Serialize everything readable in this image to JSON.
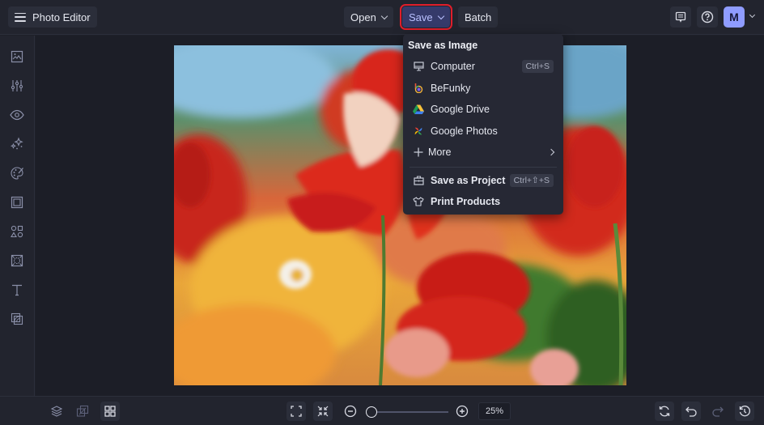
{
  "app": {
    "title": "Photo Editor"
  },
  "topbar": {
    "open_label": "Open",
    "save_label": "Save",
    "batch_label": "Batch",
    "avatar_initial": "M",
    "colors": {
      "save_highlight": "#e01e2b",
      "avatar_bg": "#8f9cff"
    }
  },
  "sidebar": {
    "items": [
      {
        "icon": "image-icon",
        "name": "sidebar-item-image"
      },
      {
        "icon": "sliders-icon",
        "name": "sidebar-item-edit"
      },
      {
        "icon": "eye-icon",
        "name": "sidebar-item-touch-up"
      },
      {
        "icon": "sparkles-icon",
        "name": "sidebar-item-effects"
      },
      {
        "icon": "palette-icon",
        "name": "sidebar-item-artsy"
      },
      {
        "icon": "frame-icon",
        "name": "sidebar-item-frames"
      },
      {
        "icon": "shapes-icon",
        "name": "sidebar-item-graphics"
      },
      {
        "icon": "overlay-icon",
        "name": "sidebar-item-overlays"
      },
      {
        "icon": "text-icon",
        "name": "sidebar-item-text"
      },
      {
        "icon": "textures-icon",
        "name": "sidebar-item-textures"
      }
    ]
  },
  "save_menu": {
    "header": "Save as Image",
    "items": [
      {
        "label": "Computer",
        "icon": "monitor-icon",
        "shortcut": "Ctrl+S"
      },
      {
        "label": "BeFunky",
        "icon": "befunky-logo-icon",
        "shortcut": ""
      },
      {
        "label": "Google Drive",
        "icon": "google-drive-icon",
        "shortcut": ""
      },
      {
        "label": "Google Photos",
        "icon": "google-photos-icon",
        "shortcut": ""
      },
      {
        "label": "More",
        "icon": "plus-icon",
        "shortcut": ""
      }
    ],
    "project_items": [
      {
        "label": "Save as Project",
        "icon": "briefcase-icon",
        "shortcut": "Ctrl+⇧+S"
      },
      {
        "label": "Print Products",
        "icon": "tshirt-icon",
        "shortcut": ""
      }
    ]
  },
  "bottombar": {
    "zoom_percent": "25%",
    "zoom_slider_fraction": 0.0
  }
}
